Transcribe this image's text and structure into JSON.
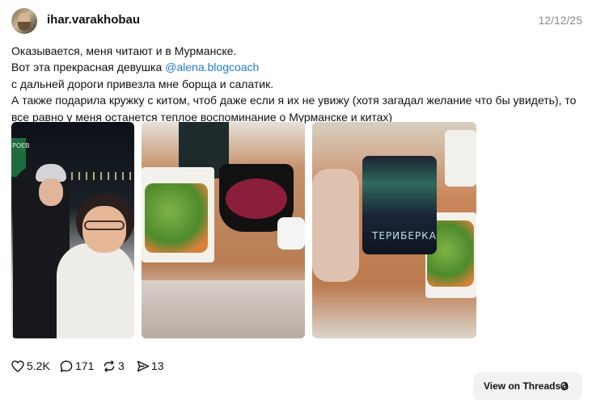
{
  "post": {
    "username": "ihar.varakhobau",
    "date": "12/12/25",
    "text": {
      "line1": "Оказывается, меня читают и в Мурманске.",
      "line2_prefix": "Вот эта прекрасная девушка ",
      "mention": "@alena.blogcoach",
      "line3": "с дальней дороги привезла мне борща и салатик.",
      "line4": "А также подарила кружку с китом, чтоб даже если я их не увижу (хотя загадал желание что бы увидеть), то",
      "line5": "все равно у меня останется теплое воспоминание о Мурманске и китах)"
    },
    "photos": {
      "photo1_sign": "РОЕВ",
      "photo3_mug_text": "ТЕРИБЕРКА"
    },
    "stats": {
      "likes": "5.2K",
      "replies": "171",
      "reposts": "3",
      "shares": "13"
    },
    "view_on_threads": "View on Threads"
  },
  "icons": {
    "like": "heart-icon",
    "reply": "comment-icon",
    "repost": "repost-icon",
    "share": "send-icon",
    "threads": "threads-logo-icon"
  },
  "colors": {
    "mention": "#1d7bd8",
    "date": "#8a8a8a",
    "button_bg": "#f2f2f2"
  }
}
